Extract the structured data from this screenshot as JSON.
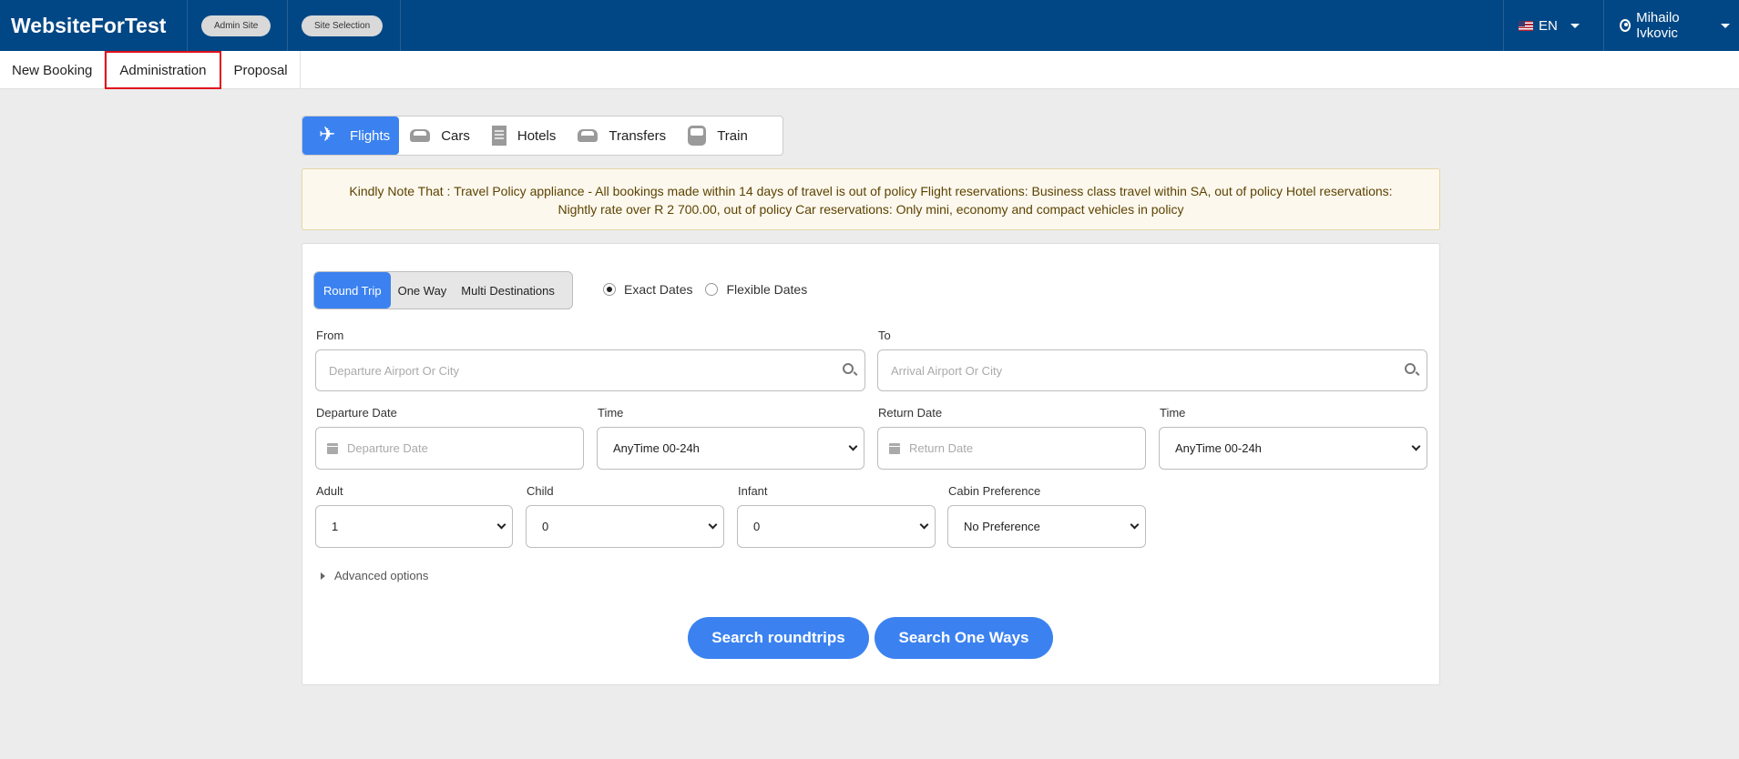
{
  "header": {
    "brand": "WebsiteForTest",
    "admin_site": "Admin Site",
    "site_selection": "Site Selection",
    "language": "EN",
    "user_name": "Mihailo Ivkovic"
  },
  "subnav": {
    "items": [
      "New Booking",
      "Administration",
      "Proposal"
    ]
  },
  "product_tabs": [
    {
      "label": "Flights",
      "icon": "plane-icon"
    },
    {
      "label": "Cars",
      "icon": "car-icon"
    },
    {
      "label": "Hotels",
      "icon": "hotel-icon"
    },
    {
      "label": "Transfers",
      "icon": "transfer-icon"
    },
    {
      "label": "Train",
      "icon": "train-icon"
    }
  ],
  "notice": {
    "text": "Kindly Note That : Travel Policy appliance - All bookings made within 14 days of travel is out of policy Flight reservations: Business class travel within SA, out of policy  Hotel reservations: Nightly rate over R 2 700.00, out of policy Car reservations: Only mini, economy and compact vehicles in policy"
  },
  "search": {
    "trip_types": [
      "Round Trip",
      "One Way",
      "Multi Destinations"
    ],
    "date_modes": [
      "Exact Dates",
      "Flexible Dates"
    ],
    "from_label": "From",
    "from_placeholder": "Departure Airport Or City",
    "to_label": "To",
    "to_placeholder": "Arrival Airport Or City",
    "departure_date_label": "Departure Date",
    "departure_date_placeholder": "Departure Date",
    "time_label": "Time",
    "departure_time_value": "AnyTime 00-24h",
    "return_date_label": "Return Date",
    "return_date_placeholder": "Return Date",
    "return_time_label": "Time",
    "return_time_value": "AnyTime 00-24h",
    "adult_label": "Adult",
    "adult_value": "1",
    "child_label": "Child",
    "child_value": "0",
    "infant_label": "Infant",
    "infant_value": "0",
    "cabin_label": "Cabin Preference",
    "cabin_value": "No Preference",
    "advanced_options": "Advanced options",
    "search_roundtrips": "Search roundtrips",
    "search_one_ways": "Search One Ways"
  },
  "colors": {
    "header_bg": "#014785",
    "accent": "#3b82f0",
    "highlight_outline": "#e0121b"
  }
}
